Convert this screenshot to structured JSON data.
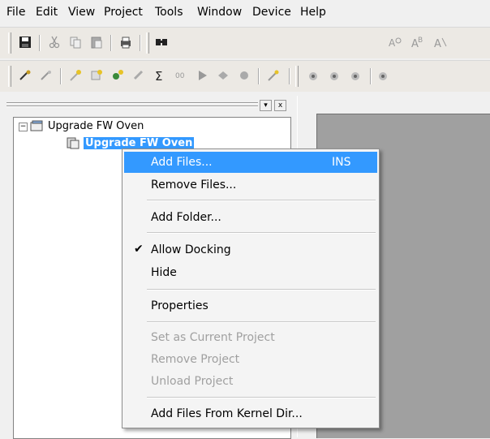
{
  "menubar": {
    "items": [
      "File",
      "Edit",
      "View",
      "Project",
      "Tools",
      "Window",
      "Device",
      "Help"
    ]
  },
  "toolbar1": {
    "find_input_value": ""
  },
  "tree": {
    "root_expander": "−",
    "root_label": "Upgrade FW Oven",
    "child_label": "Upgrade FW Oven"
  },
  "context_menu": {
    "add_files": "Add Files...",
    "add_files_shortcut": "INS",
    "remove_files": "Remove Files...",
    "add_folder": "Add Folder...",
    "allow_docking": "Allow Docking",
    "allow_docking_check": "✔",
    "hide": "Hide",
    "properties": "Properties",
    "set_current": "Set as Current Project",
    "remove_project": "Remove Project",
    "unload_project": "Unload Project",
    "add_from_kernel": "Add Files From Kernel Dir..."
  },
  "panel": {
    "pin_glyph": "▾",
    "close_glyph": "x"
  },
  "colors": {
    "highlight": "#3399ff",
    "disabled_text": "#a0a0a0",
    "client_area": "#a0a0a0"
  }
}
